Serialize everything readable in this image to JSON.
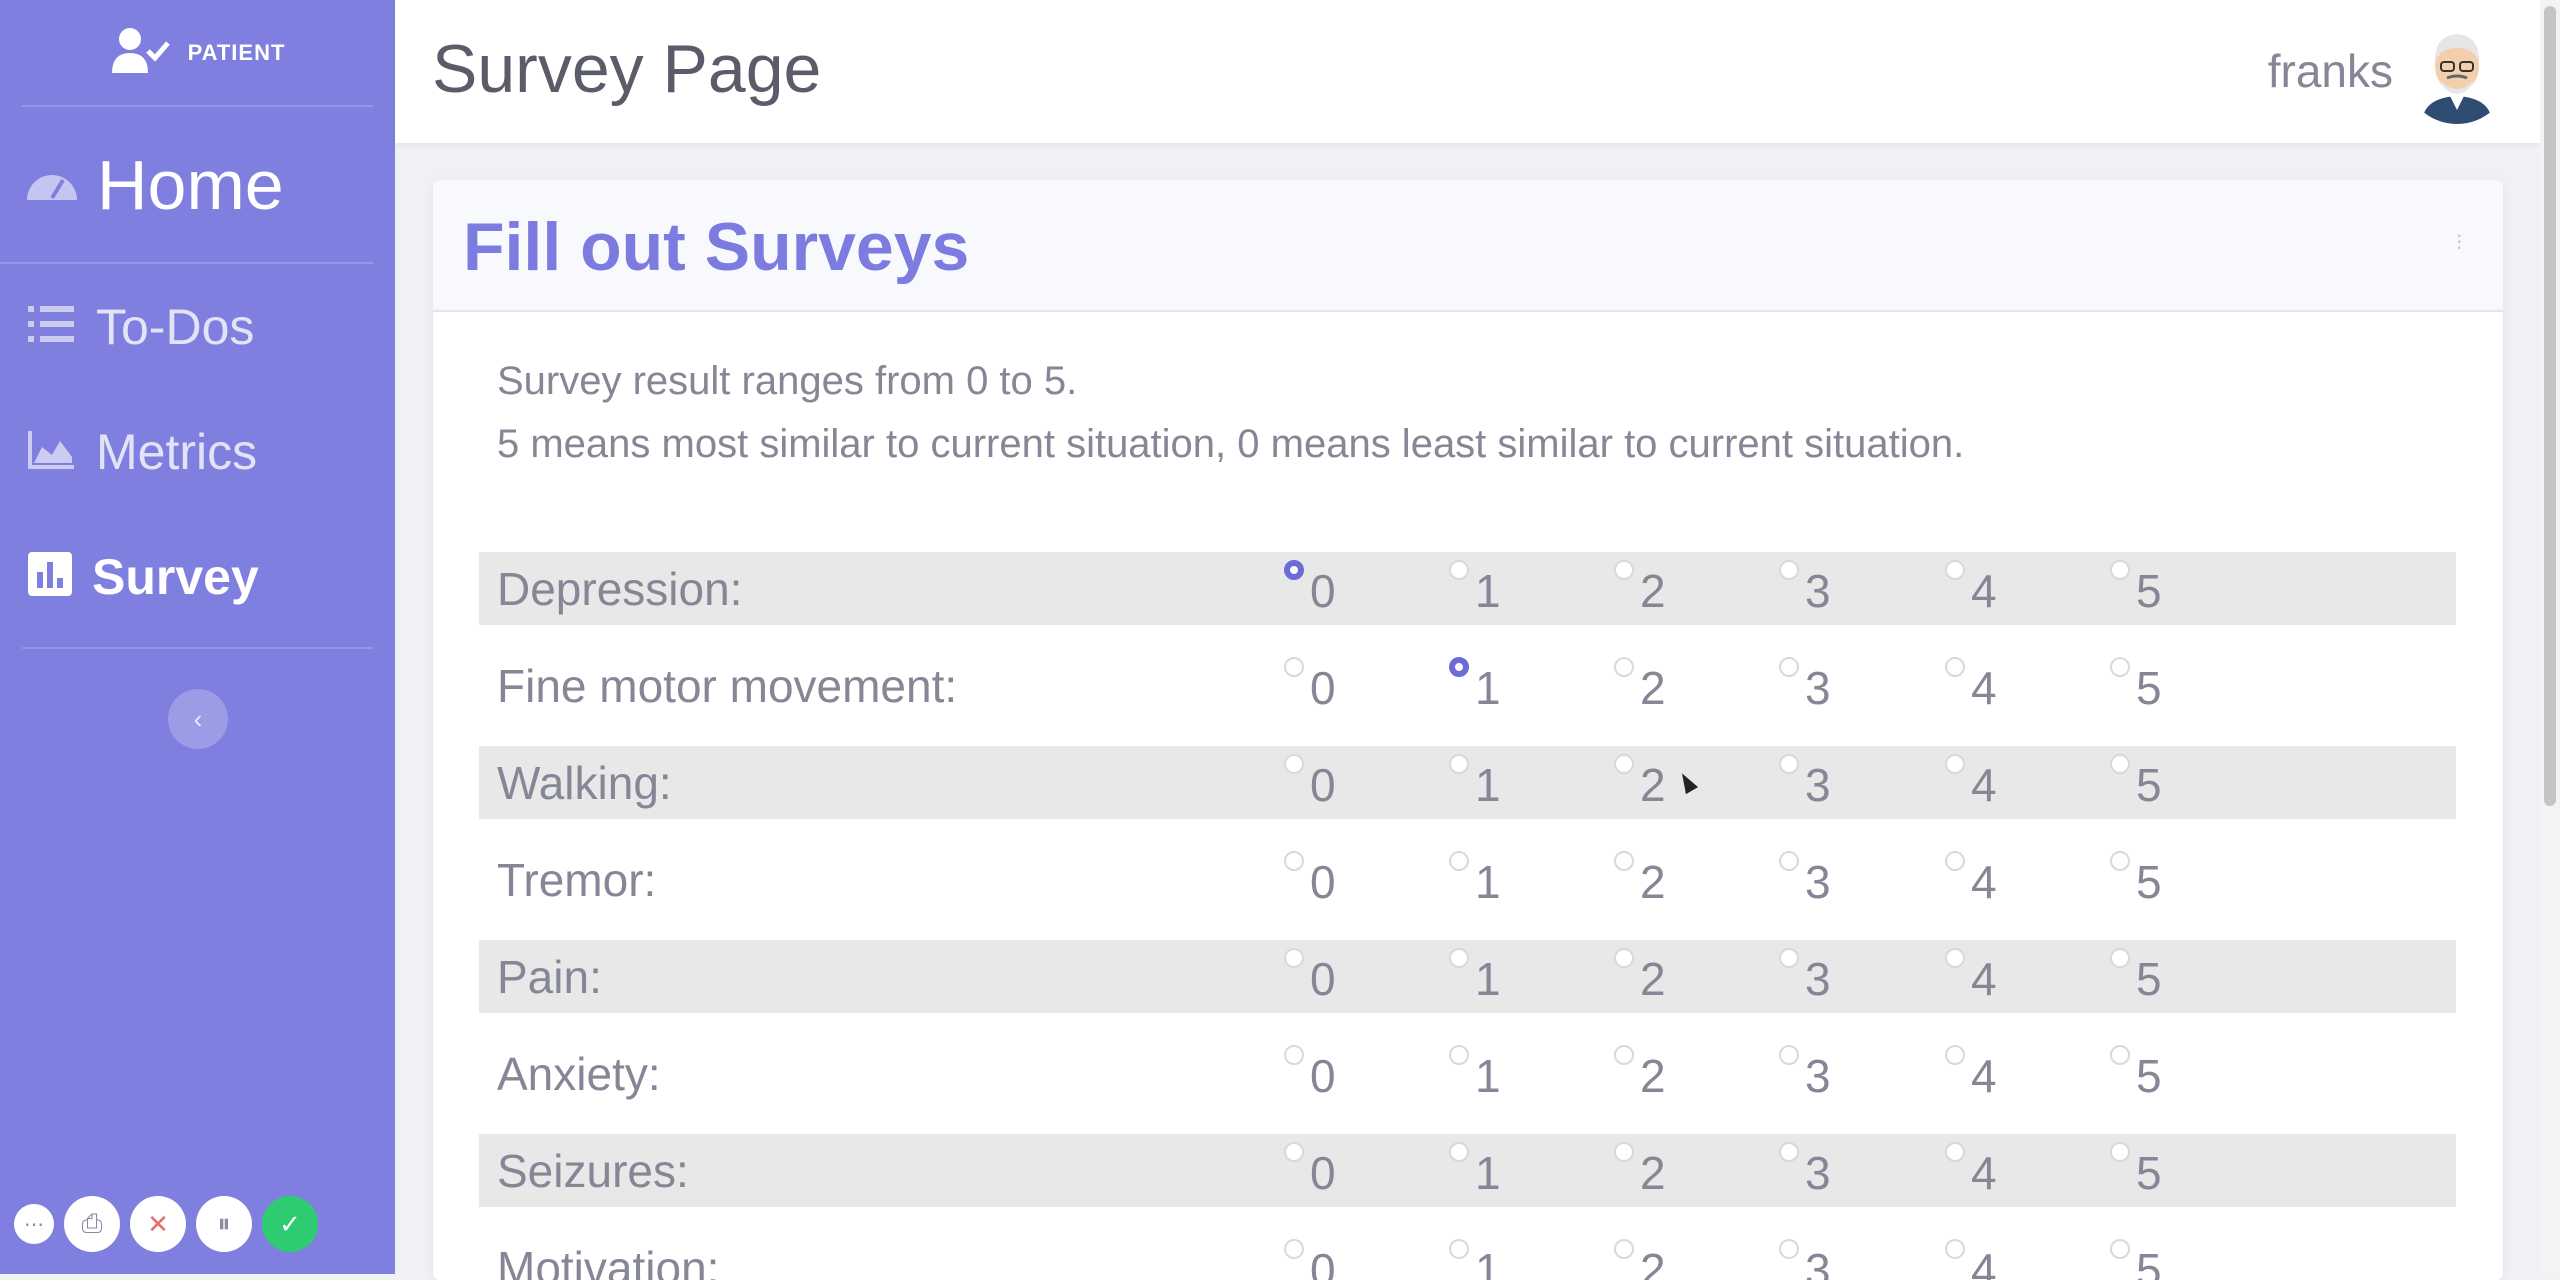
{
  "sidebar": {
    "brand_label": "PATIENT",
    "items": [
      {
        "label": "Home",
        "icon": "dashboard-icon"
      },
      {
        "label": "To-Dos",
        "icon": "list-icon"
      },
      {
        "label": "Metrics",
        "icon": "chart-area-icon"
      },
      {
        "label": "Survey",
        "icon": "poll-icon",
        "active": true
      }
    ],
    "collapse_symbol": "‹"
  },
  "header": {
    "title": "Survey Page",
    "username": "franks"
  },
  "card": {
    "title": "Fill out Surveys",
    "intro_line1": "Survey result ranges from 0 to 5.",
    "intro_line2": "5 means most similar to current situation, 0 means least similar to current situation."
  },
  "survey": {
    "options": [
      "0",
      "1",
      "2",
      "3",
      "4",
      "5"
    ],
    "questions": [
      {
        "label": "Depression:",
        "selected": 0
      },
      {
        "label": "Fine motor movement:",
        "selected": 1
      },
      {
        "label": "Walking:",
        "selected": null
      },
      {
        "label": "Tremor:",
        "selected": null
      },
      {
        "label": "Pain:",
        "selected": null
      },
      {
        "label": "Anxiety:",
        "selected": null
      },
      {
        "label": "Seizures:",
        "selected": null
      },
      {
        "label": "Motivation:",
        "selected": null
      }
    ]
  },
  "recorder": {
    "more": "⋯",
    "camera": "⎙",
    "cancel": "✕",
    "pause": "⏸",
    "done": "✓"
  },
  "colors": {
    "sidebar": "#7f7fdf",
    "accent": "#7b7be0",
    "text": "#858796"
  }
}
